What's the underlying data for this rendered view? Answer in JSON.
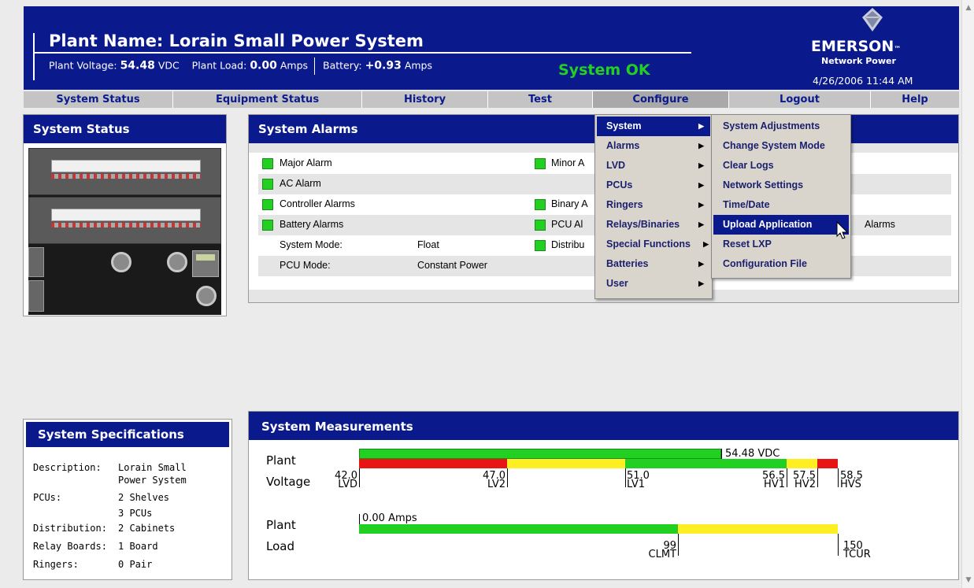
{
  "header": {
    "plant_name": "Plant Name: Lorain Small Power System",
    "voltage_label": "Plant Voltage:",
    "voltage_value": "54.48",
    "voltage_unit": "VDC",
    "load_label": "Plant Load:",
    "load_value": "0.00",
    "load_unit": "Amps",
    "battery_label": "Battery:",
    "battery_value": "+0.93",
    "battery_unit": "Amps",
    "status": "System OK",
    "logo": "EMERSON",
    "logo_tm": "™",
    "logo_sub": "Network Power",
    "datetime": "4/26/2006 11:44 AM"
  },
  "nav": {
    "tabs": [
      {
        "label": "System Status"
      },
      {
        "label": "Equipment Status"
      },
      {
        "label": "History"
      },
      {
        "label": "Test"
      },
      {
        "label": "Configure"
      },
      {
        "label": "Logout"
      },
      {
        "label": "Help"
      }
    ]
  },
  "status_panel": {
    "title": "System Status"
  },
  "alarms_panel": {
    "title": "System Alarms",
    "rows": [
      {
        "left": "Major Alarm",
        "right": "Minor A"
      },
      {
        "left": "AC Alarm",
        "right": ""
      },
      {
        "left": "Controller Alarms",
        "right": "Binary A"
      },
      {
        "left": "Battery Alarms",
        "right": "PCU Al",
        "far": "Alarms"
      },
      {
        "left": "System Mode:",
        "value": "Float",
        "right": "Distribu"
      },
      {
        "left": "PCU Mode:",
        "value": "Constant Power"
      }
    ]
  },
  "configure_menu": {
    "items": [
      "System",
      "Alarms",
      "LVD",
      "PCUs",
      "Ringers",
      "Relays/Binaries",
      "Special Functions",
      "Batteries",
      "User"
    ]
  },
  "system_submenu": {
    "items": [
      "System Adjustments",
      "Change System Mode",
      "Clear Logs",
      "Network Settings",
      "Time/Date",
      "Upload Application",
      "Reset LXP",
      "Configuration File"
    ]
  },
  "specs_panel": {
    "title": "System Specifications",
    "rows": [
      {
        "label": "Description:",
        "value": "Lorain Small"
      },
      {
        "label": "",
        "value": "Power System"
      },
      {
        "label": "PCUs:",
        "value": "2 Shelves"
      },
      {
        "label": "",
        "value": "3 PCUs"
      },
      {
        "label": "Distribution:",
        "value": "2 Cabinets"
      },
      {
        "label": "Relay Boards:",
        "value": "1 Board"
      },
      {
        "label": "Ringers:",
        "value": "0 Pair"
      }
    ]
  },
  "measurements_panel": {
    "title": "System Measurements",
    "voltage": {
      "label1": "Plant",
      "label2": "Voltage",
      "reading": "54.48 VDC",
      "ticks": [
        {
          "v": "42.0",
          "n": "LVD"
        },
        {
          "v": "47.0",
          "n": "LV2"
        },
        {
          "v": "51.0",
          "n": "LV1"
        },
        {
          "v": "56.5",
          "n": "HV1"
        },
        {
          "v": "57.5",
          "n": "HV2"
        },
        {
          "v": "58.5",
          "n": "HVS"
        }
      ]
    },
    "load": {
      "label1": "Plant",
      "label2": "Load",
      "reading": "0.00 Amps",
      "ticks": [
        {
          "v": "99",
          "n": "CLMT"
        },
        {
          "v": "150",
          "n": "TCUR"
        }
      ]
    }
  },
  "colors": {
    "header_blue": "#0a1a8c",
    "ok_green": "#22d022",
    "bar_red": "#e81515",
    "bar_yellow": "#ffee22"
  }
}
